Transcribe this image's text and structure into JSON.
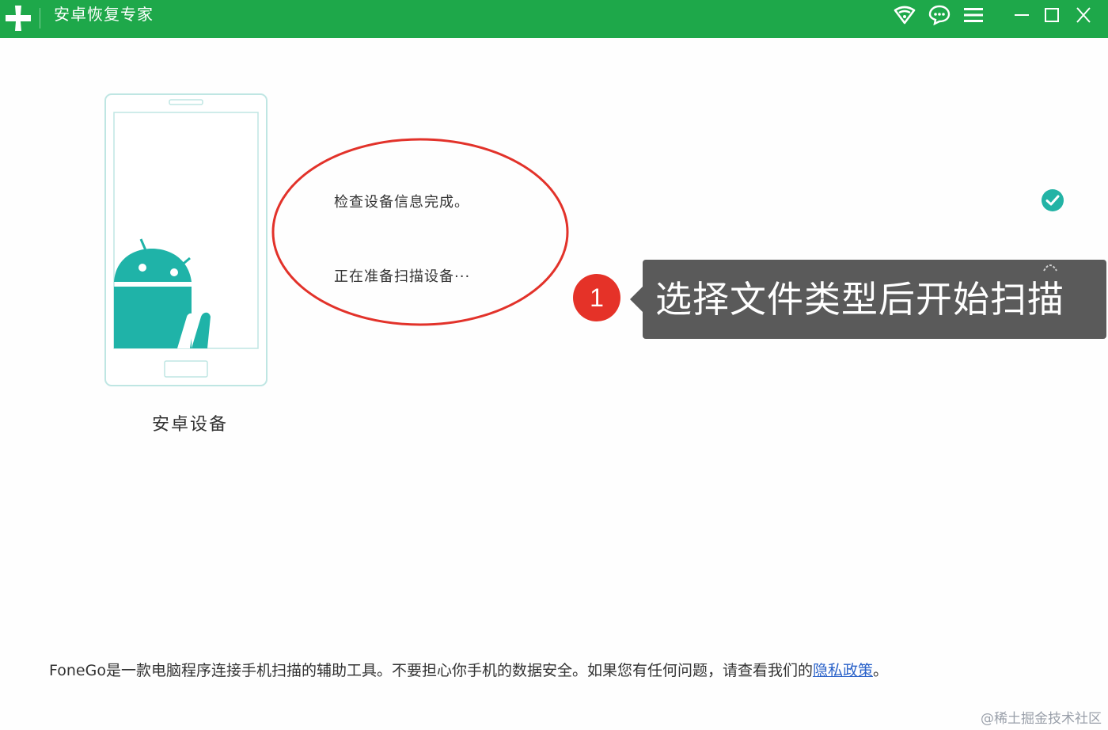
{
  "window": {
    "title": "安卓恢复专家",
    "accent_color": "#1ea84a"
  },
  "titlebar_icons": [
    "wifi-icon",
    "chat-icon",
    "menu-icon",
    "minimize-icon",
    "maximize-icon",
    "close-icon"
  ],
  "device": {
    "label": "安卓设备",
    "illustration_icon": "android-phone-icon"
  },
  "status": {
    "line1": "检查设备信息完成。",
    "line2": "正在准备扫描设备···",
    "complete_icon": "check-circle-icon"
  },
  "annotation": {
    "step_number": "1",
    "text": "选择文件类型后开始扫描",
    "badge_color": "#e53228"
  },
  "footer": {
    "text": "FoneGo是一款电脑程序连接手机扫描的辅助工具。不要担心你手机的数据安全。如果您有任何问题，请查看我们的",
    "link_text": "隐私政策",
    "suffix": "。"
  },
  "watermark": "@稀土掘金技术社区"
}
